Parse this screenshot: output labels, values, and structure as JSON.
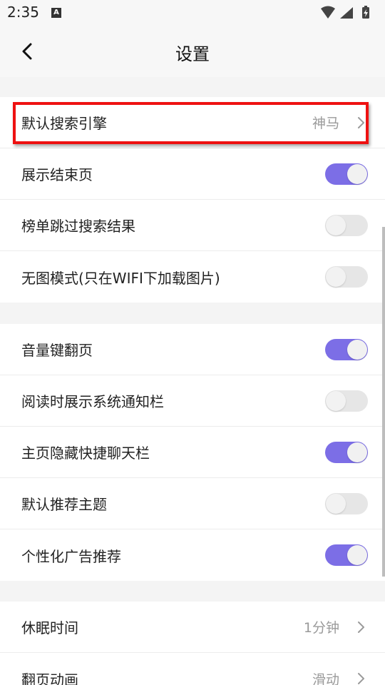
{
  "status_bar": {
    "time": "2:35",
    "notification_icon_letter": "A",
    "icons": [
      "wifi-icon",
      "signal-icon",
      "battery-charging-icon"
    ]
  },
  "header": {
    "title": "设置",
    "back_icon": "chevron-left-icon"
  },
  "groups": [
    {
      "items": [
        {
          "label": "默认搜索引擎",
          "type": "link",
          "value": "神马"
        },
        {
          "label": "展示结束页",
          "type": "toggle",
          "on": true
        },
        {
          "label": "榜单跳过搜索结果",
          "type": "toggle",
          "on": false
        },
        {
          "label": "无图模式(只在WIFI下加载图片)",
          "type": "toggle",
          "on": false
        }
      ]
    },
    {
      "items": [
        {
          "label": "音量键翻页",
          "type": "toggle",
          "on": true
        },
        {
          "label": "阅读时展示系统通知栏",
          "type": "toggle",
          "on": false
        },
        {
          "label": "主页隐藏快捷聊天栏",
          "type": "toggle",
          "on": true
        },
        {
          "label": "默认推荐主题",
          "type": "toggle",
          "on": false
        },
        {
          "label": "个性化广告推荐",
          "type": "toggle",
          "on": true
        }
      ]
    },
    {
      "items": [
        {
          "label": "休眠时间",
          "type": "link",
          "value": "1分钟"
        },
        {
          "label": "翻页动画",
          "type": "link",
          "value": "滑动"
        }
      ]
    }
  ],
  "colors": {
    "toggle_on": "#7c6ee6",
    "toggle_off": "#e6e6e6",
    "highlight": "#ee1111"
  }
}
